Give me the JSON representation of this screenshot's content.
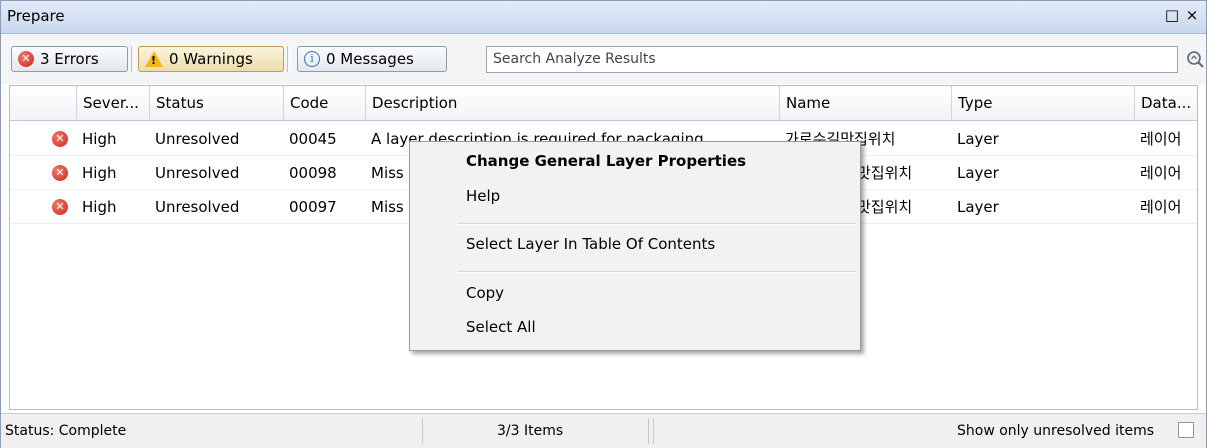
{
  "panel": {
    "title": "Prepare",
    "maximize_glyph": "□",
    "close_glyph": "×"
  },
  "filters": {
    "errors_label": "3 Errors",
    "warnings_label": "0 Warnings",
    "messages_label": "0 Messages"
  },
  "search": {
    "placeholder": "Search Analyze Results"
  },
  "table": {
    "columns": [
      "Sever...",
      "Status",
      "Code",
      "Description",
      "Name",
      "Type",
      "Data..."
    ],
    "rows": [
      {
        "severity": "High",
        "status": "Unresolved",
        "code": "00045",
        "description": "A layer description is required for packaging",
        "name": "가로수길맛집위치",
        "type": "Layer",
        "data": "레이어"
      },
      {
        "severity": "High",
        "status": "Unresolved",
        "code": "00098",
        "description": "Miss",
        "name": "맛집위치",
        "type": "Layer",
        "data": "레이어"
      },
      {
        "severity": "High",
        "status": "Unresolved",
        "code": "00097",
        "description": "Miss",
        "name": "맛집위치",
        "type": "Layer",
        "data": "레이어"
      }
    ]
  },
  "context_menu": {
    "items": [
      "Change General Layer Properties",
      "Help",
      "Select Layer In Table Of Contents",
      "Copy",
      "Select All"
    ]
  },
  "statusbar": {
    "status": "Status: Complete",
    "items": "3/3 Items",
    "unresolved_label": "Show only unresolved items"
  },
  "colors": {
    "error": "#c8261a",
    "warning": "#f0b918",
    "info": "#3a6fc4",
    "titlebar": "#c9d8ee"
  }
}
